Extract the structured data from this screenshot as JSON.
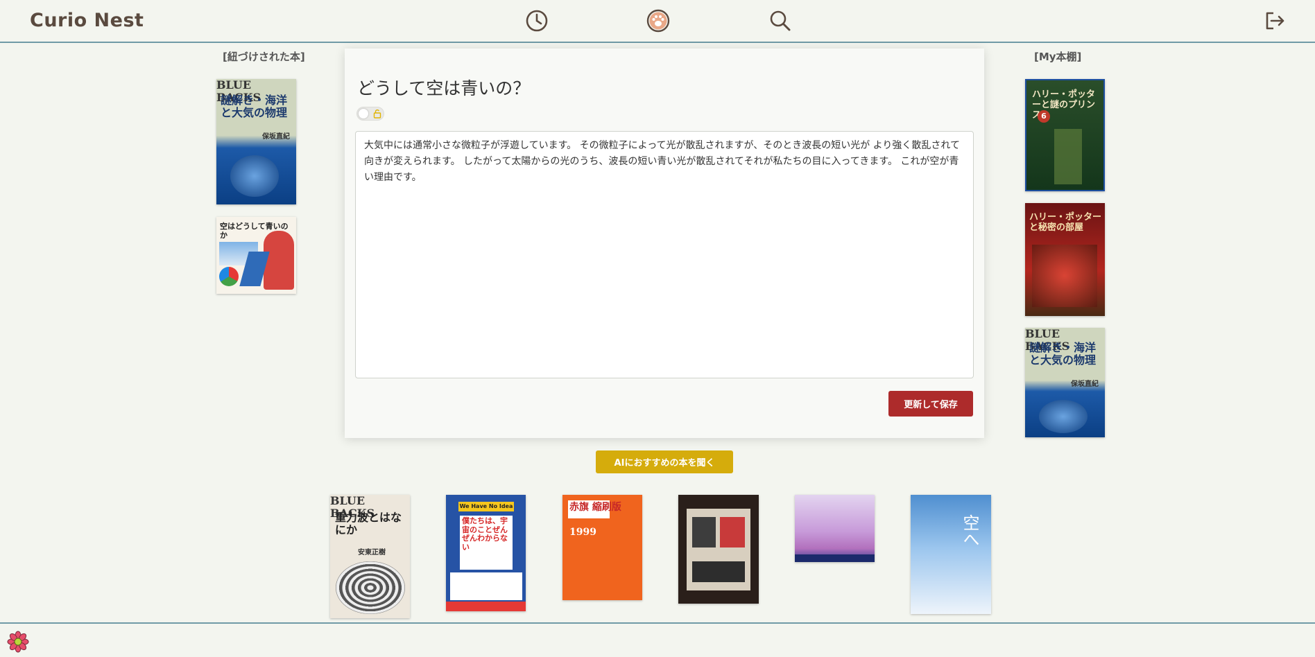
{
  "app": {
    "title": "Curio Nest"
  },
  "header": {
    "icons": [
      "history-icon",
      "paw-icon",
      "search-icon",
      "logout-icon"
    ]
  },
  "left": {
    "title": "[紐づけされた本]",
    "books": [
      {
        "title": "謎解き・海洋と大気の物理",
        "series": "BLUE BACKS",
        "author": "保坂直紀"
      },
      {
        "title": "空はどうして青いのか"
      }
    ]
  },
  "right": {
    "title": "[My本棚]",
    "books": [
      {
        "title": "ハリー・ポッターと謎のプリンス",
        "badge": "6"
      },
      {
        "title": "ハリー・ポッターと秘密の部屋"
      },
      {
        "title": "謎解き・海洋と大気の物理",
        "series": "BLUE BACKS",
        "author": "保坂直紀"
      }
    ]
  },
  "main": {
    "question": "どうして空は青いの？",
    "answer": "大気中には通常小さな微粒子が浮遊しています。 その微粒子によって光が散乱されますが、そのとき波長の短い光が より強く散乱されて向きが変えられます。 したがって太陽からの光のうち、波長の短い青い光が散乱されてそれが私たちの目に入ってきます。 これが空が青い理由です。",
    "save_label": "更新して保存",
    "ai_label": "AIにおすすめの本を聞く"
  },
  "recommendations": [
    {
      "title": "重力波とはなにか",
      "series": "BLUE BACKS",
      "author": "安東正樹"
    },
    {
      "title": "僕たちは、宇宙のことぜんぜんわからない",
      "banner": "We Have No Idea"
    },
    {
      "title": "赤旗 縮刷版",
      "year": "1999"
    },
    {
      "title": ""
    },
    {
      "title": ""
    },
    {
      "title": "空へ"
    }
  ],
  "colors": {
    "background": "#f3f5ef",
    "header_border": "#6f9aa6",
    "save_button": "#ad2b2b",
    "ai_button": "#d5ac0c"
  }
}
